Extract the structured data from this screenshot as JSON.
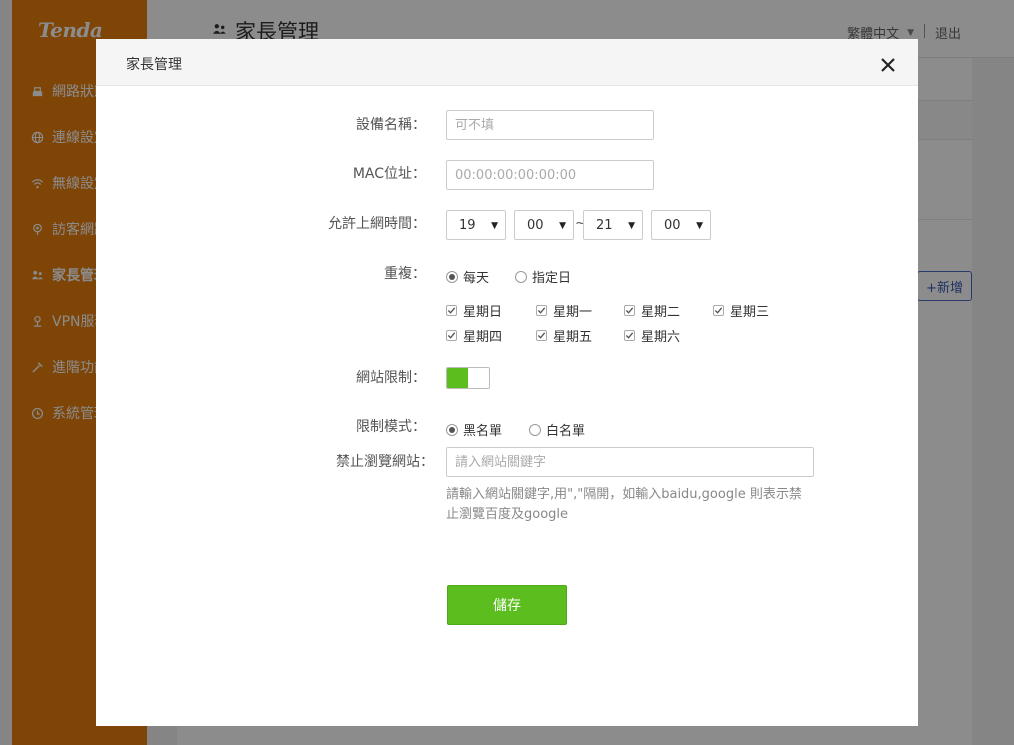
{
  "app": {
    "logo": "Tenda",
    "page_title": "家長管理",
    "language": "繁體中文",
    "logout": "退出",
    "add_button": "+新增"
  },
  "sidebar": {
    "items": [
      {
        "label": "網路狀態",
        "icon": "network-status-icon"
      },
      {
        "label": "連線設定",
        "icon": "globe-icon"
      },
      {
        "label": "無線設定",
        "icon": "wifi-icon"
      },
      {
        "label": "訪客網路",
        "icon": "guest-icon"
      },
      {
        "label": "家長管理",
        "icon": "parents-icon",
        "active": true
      },
      {
        "label": "VPN服務",
        "icon": "vpn-icon"
      },
      {
        "label": "進階功能",
        "icon": "tools-icon"
      },
      {
        "label": "系統管理",
        "icon": "system-icon"
      }
    ]
  },
  "modal": {
    "title": "家長管理",
    "device_name": {
      "label": "設備名稱：",
      "value": "",
      "placeholder": "可不填"
    },
    "mac": {
      "label": "MAC位址：",
      "value": "",
      "placeholder": "00:00:00:00:00:00"
    },
    "time": {
      "label": "允許上網時間：",
      "start_hour": "19",
      "start_minute": "00",
      "separator": "~",
      "end_hour": "21",
      "end_minute": "00"
    },
    "repeat": {
      "label": "重複：",
      "options": [
        {
          "label": "每天",
          "selected": true
        },
        {
          "label": "指定日",
          "selected": false
        }
      ],
      "days": [
        {
          "label": "星期日",
          "checked": true
        },
        {
          "label": "星期一",
          "checked": true
        },
        {
          "label": "星期二",
          "checked": true
        },
        {
          "label": "星期三",
          "checked": true
        },
        {
          "label": "星期四",
          "checked": true
        },
        {
          "label": "星期五",
          "checked": true
        },
        {
          "label": "星期六",
          "checked": true
        }
      ]
    },
    "site_limit": {
      "label": "網站限制：",
      "enabled": true
    },
    "limit_mode": {
      "label": "限制模式：",
      "options": [
        {
          "label": "黑名單",
          "selected": true
        },
        {
          "label": "白名單",
          "selected": false
        }
      ]
    },
    "blocked_sites": {
      "label": "禁止瀏覽網站：",
      "value": "",
      "placeholder": "請入網站關鍵字",
      "hint": "請輸入網站關鍵字,用\",\"隔開，如輸入baidu,google 則表示禁止瀏覽百度及google"
    },
    "save_label": "儲存"
  },
  "colors": {
    "sidebar": "#e57e0e",
    "accent_green": "#5cbd1e",
    "add_button_border": "#4a6bc4"
  }
}
